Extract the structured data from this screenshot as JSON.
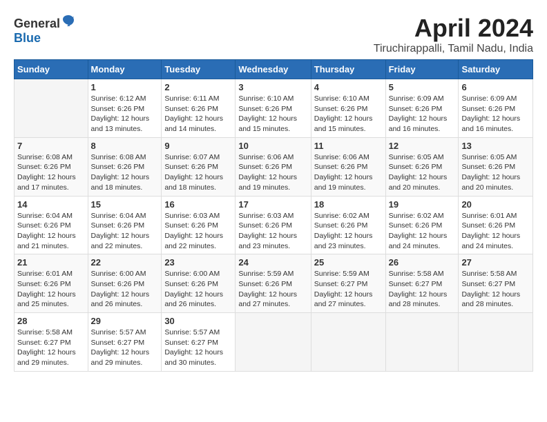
{
  "header": {
    "logo_general": "General",
    "logo_blue": "Blue",
    "title": "April 2024",
    "subtitle": "Tiruchirappalli, Tamil Nadu, India"
  },
  "days_of_week": [
    "Sunday",
    "Monday",
    "Tuesday",
    "Wednesday",
    "Thursday",
    "Friday",
    "Saturday"
  ],
  "weeks": [
    [
      {
        "day": "",
        "content": ""
      },
      {
        "day": "1",
        "content": "Sunrise: 6:12 AM\nSunset: 6:26 PM\nDaylight: 12 hours\nand 13 minutes."
      },
      {
        "day": "2",
        "content": "Sunrise: 6:11 AM\nSunset: 6:26 PM\nDaylight: 12 hours\nand 14 minutes."
      },
      {
        "day": "3",
        "content": "Sunrise: 6:10 AM\nSunset: 6:26 PM\nDaylight: 12 hours\nand 15 minutes."
      },
      {
        "day": "4",
        "content": "Sunrise: 6:10 AM\nSunset: 6:26 PM\nDaylight: 12 hours\nand 15 minutes."
      },
      {
        "day": "5",
        "content": "Sunrise: 6:09 AM\nSunset: 6:26 PM\nDaylight: 12 hours\nand 16 minutes."
      },
      {
        "day": "6",
        "content": "Sunrise: 6:09 AM\nSunset: 6:26 PM\nDaylight: 12 hours\nand 16 minutes."
      }
    ],
    [
      {
        "day": "7",
        "content": "Sunrise: 6:08 AM\nSunset: 6:26 PM\nDaylight: 12 hours\nand 17 minutes."
      },
      {
        "day": "8",
        "content": "Sunrise: 6:08 AM\nSunset: 6:26 PM\nDaylight: 12 hours\nand 18 minutes."
      },
      {
        "day": "9",
        "content": "Sunrise: 6:07 AM\nSunset: 6:26 PM\nDaylight: 12 hours\nand 18 minutes."
      },
      {
        "day": "10",
        "content": "Sunrise: 6:06 AM\nSunset: 6:26 PM\nDaylight: 12 hours\nand 19 minutes."
      },
      {
        "day": "11",
        "content": "Sunrise: 6:06 AM\nSunset: 6:26 PM\nDaylight: 12 hours\nand 19 minutes."
      },
      {
        "day": "12",
        "content": "Sunrise: 6:05 AM\nSunset: 6:26 PM\nDaylight: 12 hours\nand 20 minutes."
      },
      {
        "day": "13",
        "content": "Sunrise: 6:05 AM\nSunset: 6:26 PM\nDaylight: 12 hours\nand 20 minutes."
      }
    ],
    [
      {
        "day": "14",
        "content": "Sunrise: 6:04 AM\nSunset: 6:26 PM\nDaylight: 12 hours\nand 21 minutes."
      },
      {
        "day": "15",
        "content": "Sunrise: 6:04 AM\nSunset: 6:26 PM\nDaylight: 12 hours\nand 22 minutes."
      },
      {
        "day": "16",
        "content": "Sunrise: 6:03 AM\nSunset: 6:26 PM\nDaylight: 12 hours\nand 22 minutes."
      },
      {
        "day": "17",
        "content": "Sunrise: 6:03 AM\nSunset: 6:26 PM\nDaylight: 12 hours\nand 23 minutes."
      },
      {
        "day": "18",
        "content": "Sunrise: 6:02 AM\nSunset: 6:26 PM\nDaylight: 12 hours\nand 23 minutes."
      },
      {
        "day": "19",
        "content": "Sunrise: 6:02 AM\nSunset: 6:26 PM\nDaylight: 12 hours\nand 24 minutes."
      },
      {
        "day": "20",
        "content": "Sunrise: 6:01 AM\nSunset: 6:26 PM\nDaylight: 12 hours\nand 24 minutes."
      }
    ],
    [
      {
        "day": "21",
        "content": "Sunrise: 6:01 AM\nSunset: 6:26 PM\nDaylight: 12 hours\nand 25 minutes."
      },
      {
        "day": "22",
        "content": "Sunrise: 6:00 AM\nSunset: 6:26 PM\nDaylight: 12 hours\nand 26 minutes."
      },
      {
        "day": "23",
        "content": "Sunrise: 6:00 AM\nSunset: 6:26 PM\nDaylight: 12 hours\nand 26 minutes."
      },
      {
        "day": "24",
        "content": "Sunrise: 5:59 AM\nSunset: 6:26 PM\nDaylight: 12 hours\nand 27 minutes."
      },
      {
        "day": "25",
        "content": "Sunrise: 5:59 AM\nSunset: 6:27 PM\nDaylight: 12 hours\nand 27 minutes."
      },
      {
        "day": "26",
        "content": "Sunrise: 5:58 AM\nSunset: 6:27 PM\nDaylight: 12 hours\nand 28 minutes."
      },
      {
        "day": "27",
        "content": "Sunrise: 5:58 AM\nSunset: 6:27 PM\nDaylight: 12 hours\nand 28 minutes."
      }
    ],
    [
      {
        "day": "28",
        "content": "Sunrise: 5:58 AM\nSunset: 6:27 PM\nDaylight: 12 hours\nand 29 minutes."
      },
      {
        "day": "29",
        "content": "Sunrise: 5:57 AM\nSunset: 6:27 PM\nDaylight: 12 hours\nand 29 minutes."
      },
      {
        "day": "30",
        "content": "Sunrise: 5:57 AM\nSunset: 6:27 PM\nDaylight: 12 hours\nand 30 minutes."
      },
      {
        "day": "",
        "content": ""
      },
      {
        "day": "",
        "content": ""
      },
      {
        "day": "",
        "content": ""
      },
      {
        "day": "",
        "content": ""
      }
    ]
  ]
}
